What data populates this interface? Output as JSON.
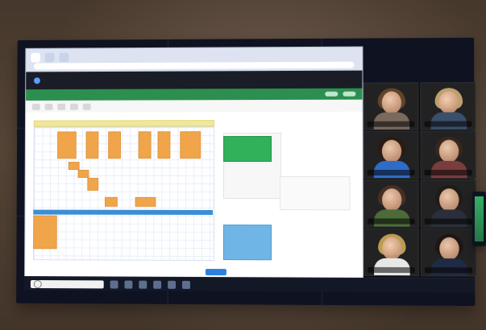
{
  "colors": {
    "sheet_green": "#2c8f4f",
    "cell_orange": "#f0a54b",
    "accent_blue": "#3b8ed6",
    "highlight_green": "#30b15a",
    "highlight_blue": "#6fb6e6"
  },
  "icons": {
    "meeting": "meeting-icon",
    "search": "search-icon",
    "taskbar_apps": [
      "app-icon",
      "app-icon",
      "app-icon",
      "app-icon",
      "app-icon",
      "app-icon"
    ]
  },
  "browser": {
    "tabs": [
      "",
      "",
      ""
    ],
    "url": ""
  },
  "meeting_bar": {
    "title": ""
  },
  "sheet": {
    "title": ""
  },
  "taskbar": {
    "search_placeholder": ""
  },
  "video_tiles": [
    {
      "name": ""
    },
    {
      "name": ""
    },
    {
      "name": ""
    },
    {
      "name": ""
    },
    {
      "name": ""
    },
    {
      "name": ""
    },
    {
      "name": ""
    },
    {
      "name": ""
    }
  ]
}
